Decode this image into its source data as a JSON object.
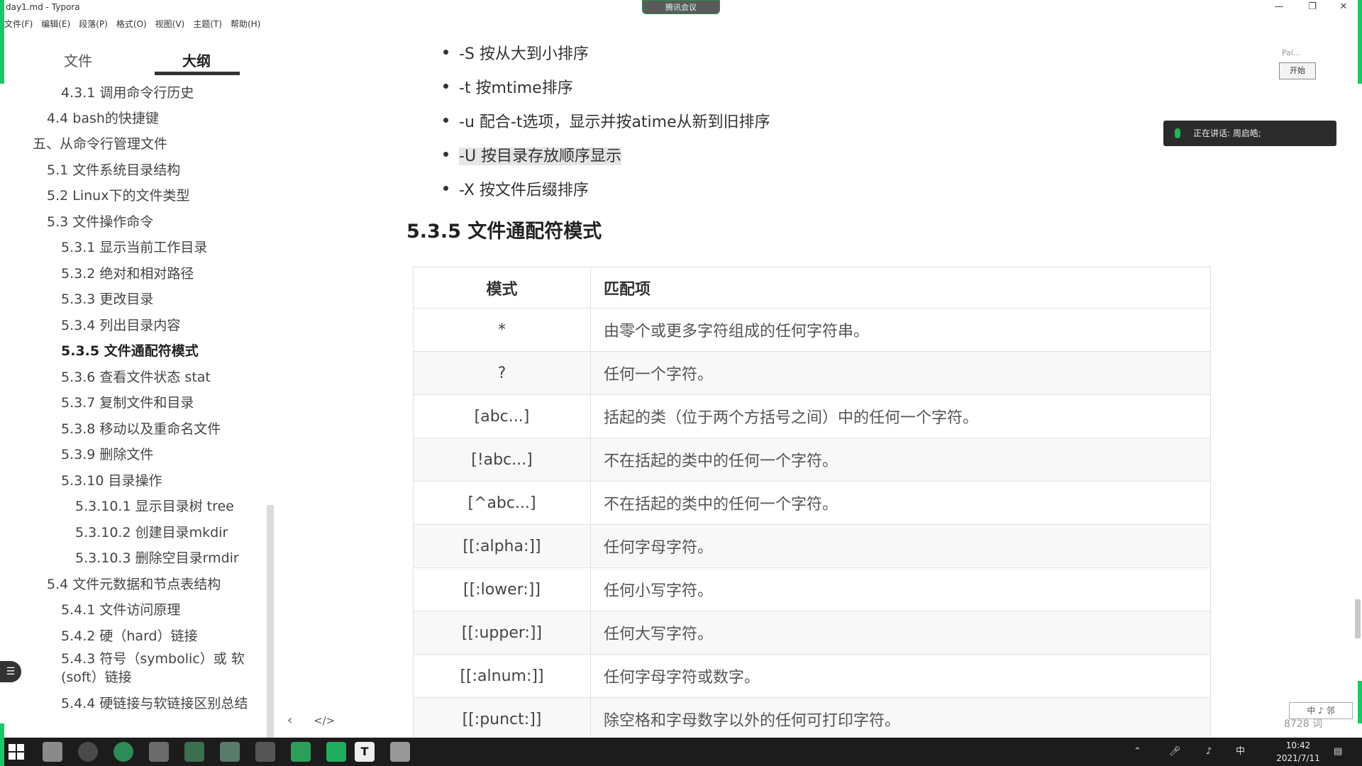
{
  "window": {
    "title": "day1.md - Typora",
    "meeting_pill": "腾讯会议"
  },
  "menu": [
    "文件(F)",
    "编辑(E)",
    "段落(P)",
    "格式(O)",
    "视图(V)",
    "主题(T)",
    "帮助(H)"
  ],
  "sidebar": {
    "tab_files": "文件",
    "tab_outline": "大纲",
    "active_tab": "大纲",
    "outline": [
      "4.3.1 调用命令行历史",
      "4.4 bash的快捷键",
      "五、从命令行管理文件",
      "5.1 文件系统目录结构",
      "5.2 Linux下的文件类型",
      "5.3 文件操作命令",
      "5.3.1 显示当前工作目录",
      "5.3.2 绝对和相对路径",
      "5.3.3 更改目录",
      "5.3.4 列出目录内容",
      "5.3.5 文件通配符模式",
      "5.3.6 查看文件状态 stat",
      "5.3.7 复制文件和目录",
      "5.3.8 移动以及重命名文件",
      "5.3.9 删除文件",
      "5.3.10 目录操作",
      "5.3.10.1 显示目录树 tree",
      "5.3.10.2 创建目录mkdir",
      "5.3.10.3 删除空目录rmdir",
      "5.4 文件元数据和节点表结构",
      "5.4.1 文件访问原理",
      "5.4.2 硬（hard）链接",
      "5.4.3 符号（symbolic）或 软 (soft）链接",
      "5.4.4 硬链接与软链接区别总结"
    ],
    "active_item": "5.3.5 文件通配符模式",
    "footer_back": "‹",
    "footer_source": "</>"
  },
  "content": {
    "bullets": [
      "-S 按从大到小排序",
      "-t 按mtime排序",
      "-u 配合-t选项，显示并按atime从新到旧排序",
      "-U 按目录存放顺序显示",
      "-X 按文件后缀排序"
    ],
    "heading": "5.3.5 文件通配符模式",
    "table": {
      "headers": [
        "模式",
        "匹配项"
      ],
      "rows": [
        [
          "*",
          "由零个或更多字符组成的任何字符串。"
        ],
        [
          "?",
          "任何一个字符。"
        ],
        [
          "[abc...]",
          "括起的类（位于两个方括号之间）中的任何一个字符。"
        ],
        [
          "[!abc...]",
          "不在括起的类中的任何一个字符。"
        ],
        [
          "[^abc...]",
          "不在括起的类中的任何一个字符。"
        ],
        [
          "[[:alpha:]]",
          "任何字母字符。"
        ],
        [
          "[[:lower:]]",
          "任何小写字符。"
        ],
        [
          "[[:upper:]]",
          "任何大写字符。"
        ],
        [
          "[[:alnum:]]",
          "任何字母字符或数字。"
        ],
        [
          "[[:punct:]]",
          "除空格和字母数字以外的任何可打印字符。"
        ]
      ]
    }
  },
  "widgets": {
    "pai_label": "Pai...",
    "pai_start": "开始",
    "speaking": "正在讲话: 周启皓;",
    "wordcount": "8728 词",
    "ime": "中 ♪ 邻"
  },
  "taskbar": {
    "tray_lang": "中",
    "time": "10:42",
    "date": "2021/7/11"
  },
  "colors": {
    "share_border": "#17c964",
    "taskbar": "#1c1c1c"
  }
}
